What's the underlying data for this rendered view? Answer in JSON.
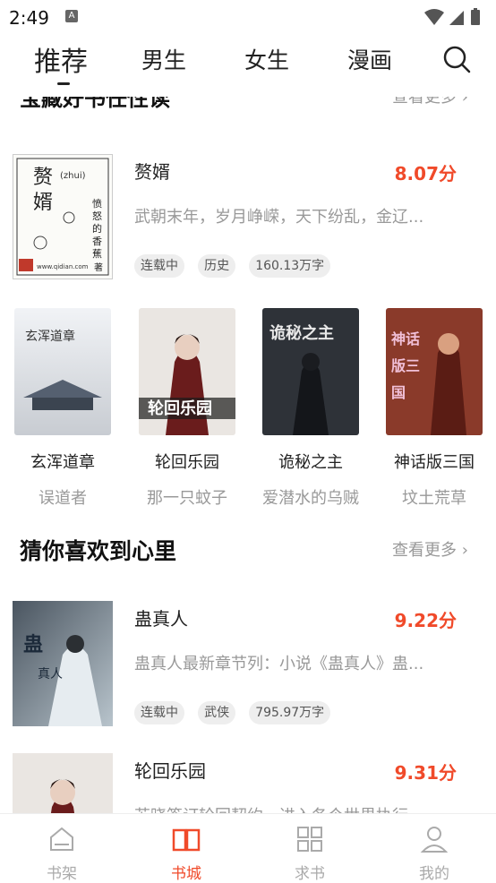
{
  "status": {
    "time": "2:49",
    "a_label": "A"
  },
  "tabs": [
    {
      "label": "推荐"
    },
    {
      "label": "男生"
    },
    {
      "label": "女生"
    },
    {
      "label": "漫画"
    }
  ],
  "prev_section": {
    "title": "宝藏好书任性读",
    "more": "查看更多 ›"
  },
  "featured1": {
    "title": "赘婿",
    "score": "8.07分",
    "desc": "武朝末年，岁月峥嵘，天下纷乱，金辽...",
    "tags": [
      "连载中",
      "历史",
      "160.13万字"
    ],
    "cover": {
      "title": "赘婿",
      "pinyin": "(zhui)",
      "author": "愤怒的香蕉",
      "site": "www.qidian.com",
      "author_mark": "著"
    }
  },
  "grid": [
    {
      "title": "玄浑道章",
      "author": "误道者",
      "cover_text": "玄浑道章"
    },
    {
      "title": "轮回乐园",
      "author": "那一只蚊子",
      "cover_text": "轮回乐园"
    },
    {
      "title": "诡秘之主",
      "author": "爱潜水的乌贼",
      "cover_text": "诡秘之主"
    },
    {
      "title": "神话版三国",
      "author": "坟土荒草",
      "cover_text": "神话版三国"
    }
  ],
  "section2": {
    "title": "猜你喜欢到心里",
    "more": "查看更多 ›"
  },
  "featured2": {
    "title": "蛊真人",
    "score": "9.22分",
    "desc": "蛊真人最新章节列：小说《蛊真人》蛊...",
    "tags": [
      "连载中",
      "武侠",
      "795.97万字"
    ],
    "cover_text": "蛊真人"
  },
  "featured3": {
    "title": "轮回乐园",
    "score": "9.31分",
    "desc": "苏晓签订轮回契约，进入各个世界执行..."
  },
  "bottom_nav": [
    {
      "label": "书架",
      "icon": "bookshelf-icon"
    },
    {
      "label": "书城",
      "icon": "book-open-icon"
    },
    {
      "label": "求书",
      "icon": "grid-icon"
    },
    {
      "label": "我的",
      "icon": "user-icon"
    }
  ],
  "colors": {
    "accent": "#f04a2a",
    "muted": "#999999"
  }
}
